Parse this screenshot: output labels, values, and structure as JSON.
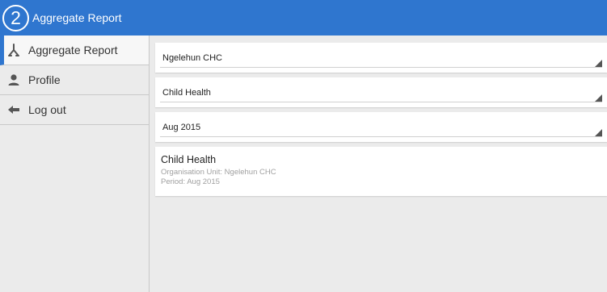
{
  "app": {
    "logo_glyph": "2",
    "title": "Aggregate Report",
    "accent": "#2f76cf"
  },
  "sidebar": {
    "items": [
      {
        "label": "Aggregate Report",
        "icon": "aggregate-fork-icon",
        "active": true
      },
      {
        "label": "Profile",
        "icon": "person-icon",
        "active": false
      },
      {
        "label": "Log out",
        "icon": "arrow-left-icon",
        "active": false
      }
    ]
  },
  "filters": {
    "org_unit": "Ngelehun CHC",
    "data_set": "Child Health",
    "period": "Aug 2015"
  },
  "report": {
    "title": "Child Health",
    "org_unit_line": "Organisation Unit: Ngelehun CHC",
    "period_line": "Period: Aug 2015"
  }
}
